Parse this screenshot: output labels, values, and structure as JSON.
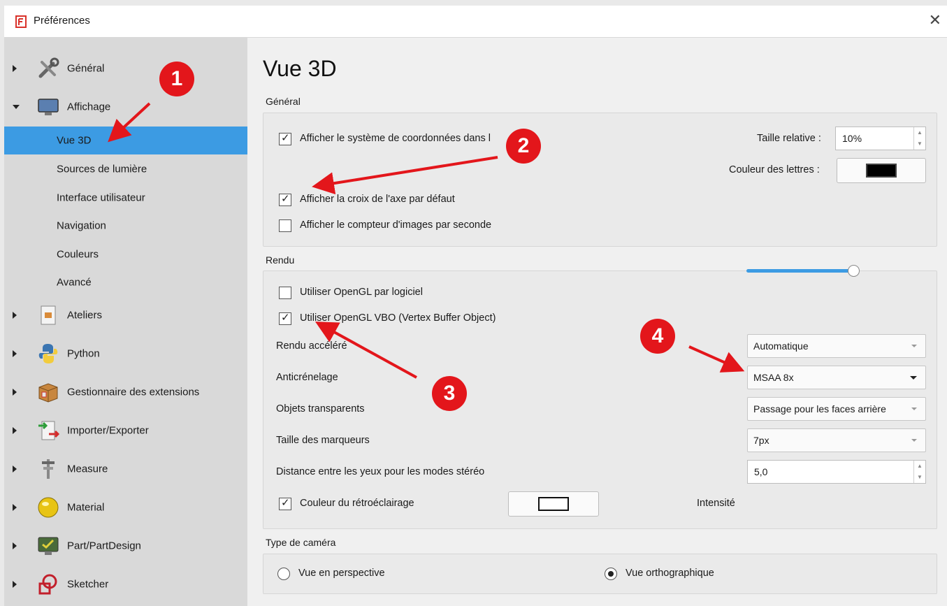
{
  "window": {
    "title": "Préférences"
  },
  "sidebar": {
    "items": [
      {
        "label": "Général"
      },
      {
        "label": "Affichage"
      },
      {
        "label": "Ateliers"
      },
      {
        "label": "Python"
      },
      {
        "label": "Gestionnaire des extensions"
      },
      {
        "label": "Importer/Exporter"
      },
      {
        "label": "Measure"
      },
      {
        "label": "Material"
      },
      {
        "label": "Part/PartDesign"
      },
      {
        "label": "Sketcher"
      }
    ],
    "subitems": [
      {
        "label": "Vue 3D"
      },
      {
        "label": "Sources de lumière"
      },
      {
        "label": "Interface utilisateur"
      },
      {
        "label": "Navigation"
      },
      {
        "label": "Couleurs"
      },
      {
        "label": "Avancé"
      }
    ]
  },
  "main": {
    "title": "Vue 3D",
    "general": {
      "section": "Général",
      "show_coord_system": "Afficher le système de coordonnées dans l",
      "relative_size_label": "Taille relative :",
      "relative_size_value": "10%",
      "letter_color_label": "Couleur des lettres :",
      "show_axis_cross": "Afficher la croix de l'axe par défaut",
      "show_fps": "Afficher le compteur d'images par seconde"
    },
    "render": {
      "section": "Rendu",
      "software_opengl": "Utiliser OpenGL par logiciel",
      "opengl_vbo": "Utiliser OpenGL VBO (Vertex Buffer Object)",
      "accelerated_label": "Rendu accéléré",
      "accelerated_value": "Automatique",
      "antialias_label": "Anticrénelage",
      "antialias_value": "MSAA 8x",
      "transparent_label": "Objets transparents",
      "transparent_value": "Passage pour les faces arrière",
      "marker_size_label": "Taille des marqueurs",
      "marker_size_value": "7px",
      "eye_distance_label": "Distance entre les yeux pour les modes stéréo",
      "eye_distance_value": "5,0",
      "backlight_label": "Couleur du rétroéclairage",
      "intensity_label": "Intensité",
      "intensity_level": 0.95
    },
    "camera": {
      "section": "Type de caméra",
      "perspective": "Vue en perspective",
      "orthographic": "Vue orthographique"
    }
  },
  "annotations": [
    "1",
    "2",
    "3",
    "4"
  ],
  "colors": {
    "accent": "#3c9be3",
    "annotation": "#e3161b"
  }
}
